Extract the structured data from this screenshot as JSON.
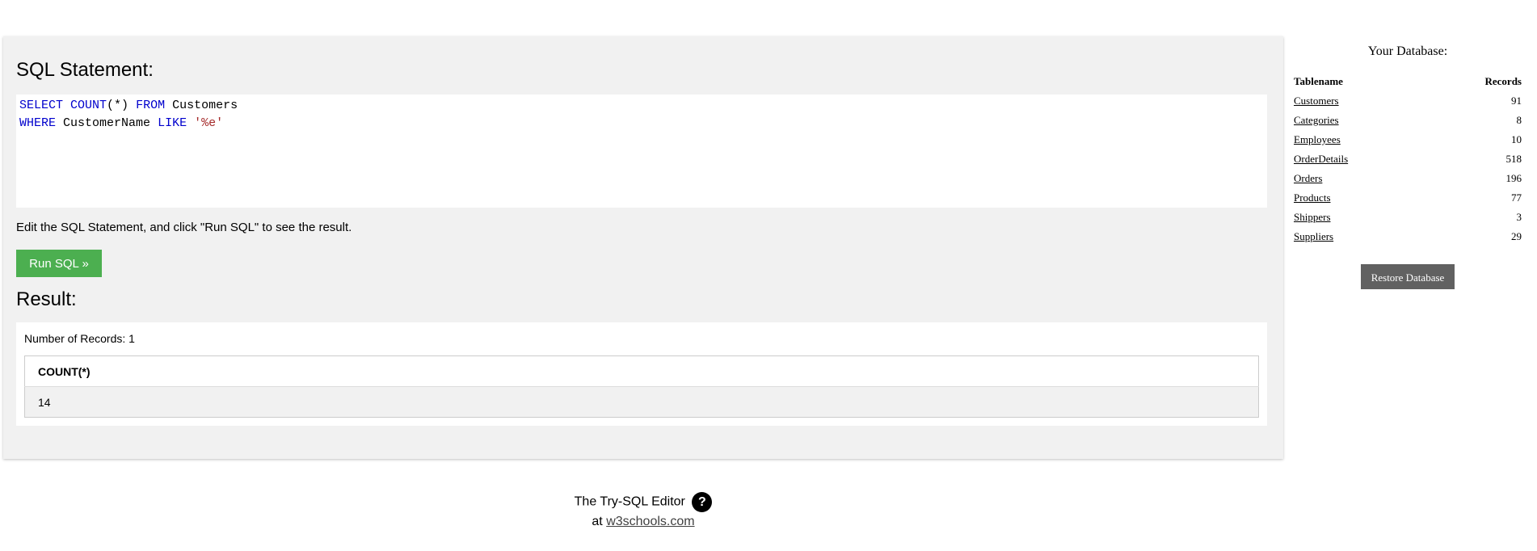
{
  "editor": {
    "title": "SQL Statement:",
    "line1": {
      "kw1": "SELECT",
      "kw2": "COUNT",
      "paren": "(*)",
      "kw3": "FROM",
      "ident": "Customers"
    },
    "line2": {
      "kw1": "WHERE",
      "ident": "CustomerName",
      "kw2": "LIKE",
      "str": "'%e'"
    },
    "hint": "Edit the SQL Statement, and click \"Run SQL\" to see the result.",
    "run_label": "Run SQL »"
  },
  "result": {
    "title": "Result:",
    "record_count": "Number of Records: 1",
    "columns": [
      "COUNT(*)"
    ],
    "rows": [
      [
        "14"
      ]
    ]
  },
  "database": {
    "title": "Your Database:",
    "col_table": "Tablename",
    "col_records": "Records",
    "tables": [
      {
        "name": "Customers",
        "records": "91"
      },
      {
        "name": "Categories",
        "records": "8"
      },
      {
        "name": "Employees",
        "records": "10"
      },
      {
        "name": "OrderDetails",
        "records": "518"
      },
      {
        "name": "Orders",
        "records": "196"
      },
      {
        "name": "Products",
        "records": "77"
      },
      {
        "name": "Shippers",
        "records": "3"
      },
      {
        "name": "Suppliers",
        "records": "29"
      }
    ],
    "restore_label": "Restore Database"
  },
  "footer": {
    "line1": "The Try-SQL Editor",
    "help_glyph": "?",
    "at": "at",
    "link": "w3schools.com"
  },
  "colors": {
    "run_button": "#4caf50",
    "restore_button": "#616161",
    "keyword": "#0000cd",
    "string": "#a52a2a"
  }
}
